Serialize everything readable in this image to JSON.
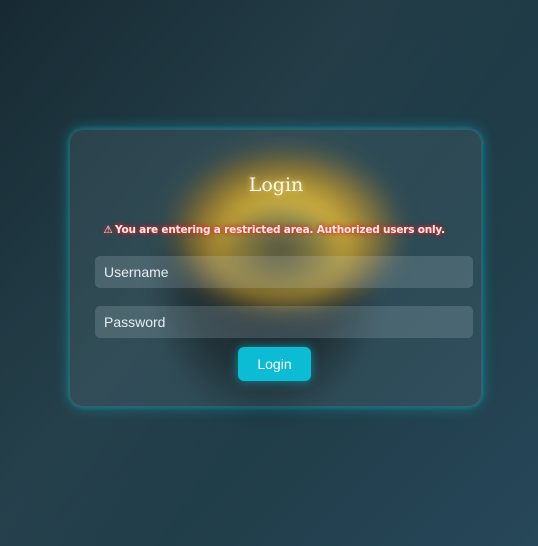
{
  "login_card": {
    "title": "Login",
    "warning": {
      "icon": "warning-icon",
      "glyph": "⚠",
      "text": "You are entering a restricted area. Authorized users only."
    },
    "username": {
      "value": "",
      "placeholder": "Username"
    },
    "password": {
      "value": "",
      "placeholder": "Password"
    },
    "submit_label": "Login"
  },
  "colors": {
    "accent": "#0cbcd4",
    "warning_glow": "#ff2828",
    "background": "#1e3a45"
  }
}
